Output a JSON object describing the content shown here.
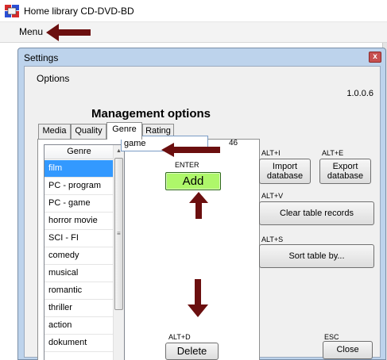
{
  "app": {
    "title": "Home library CD-DVD-BD",
    "menu_label": "Menu"
  },
  "dialog": {
    "title": "Settings",
    "close_symbol": "x",
    "options_label": "Options",
    "version": "1.0.0.6",
    "section_title": "Management options"
  },
  "tabs": [
    {
      "label": "Media",
      "active": false
    },
    {
      "label": "Quality",
      "active": false
    },
    {
      "label": "Genre",
      "active": true
    },
    {
      "label": "Rating",
      "active": false
    }
  ],
  "genre_list": {
    "header": "Genre",
    "selected_index": 0,
    "items": [
      "film",
      "PC - program",
      "PC - game",
      "horror movie",
      "SCI - FI",
      "comedy",
      "musical",
      "romantic",
      "thriller",
      "action",
      "dokument"
    ]
  },
  "genre_input": {
    "value": "game",
    "count": "46"
  },
  "buttons": {
    "enter_hotkey": "ENTER",
    "add_label": "Add",
    "delete_hotkey": "ALT+D",
    "delete_label": "Delete",
    "import_hotkey": "ALT+I",
    "import_label_line1": "Import",
    "import_label_line2": "database",
    "export_hotkey": "ALT+E",
    "export_label_line1": "Export",
    "export_label_line2": "database",
    "clear_hotkey": "ALT+V",
    "clear_label": "Clear table records",
    "sort_hotkey": "ALT+S",
    "sort_label": "Sort table by...",
    "close_hotkey": "ESC",
    "close_label": "Close"
  },
  "colors": {
    "arrow": "#6b0f0f",
    "add_button": "#aef76a",
    "selected_row": "#3399ff",
    "dialog_frame": "#bdd3ec"
  },
  "icons": {
    "app_icon": "app-logo-icon",
    "annotation_arrow": "arrow-icon"
  }
}
